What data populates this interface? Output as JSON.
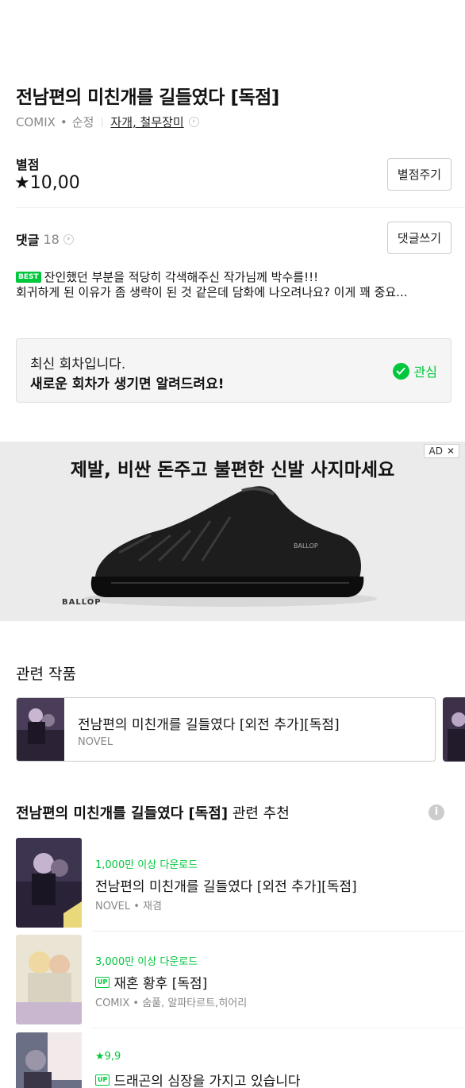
{
  "work": {
    "title": "전남편의 미친개를 길들였다 [독점]",
    "platform": "COMIX",
    "genre": "순정",
    "tags": "자개, 철무장미"
  },
  "rating": {
    "label": "별점",
    "value": "★10,00",
    "button": "별점주기"
  },
  "comments": {
    "label": "댓글",
    "count": "18",
    "button": "댓글쓰기",
    "best_badge": "BEST",
    "best_text": "잔인했던 부분을 적당히 각색해주신 작가님께 박수를!!!",
    "second_text": "회귀하게 된 이유가 좀 생략이 된 것 같은데 담화에 나오려나요? 이게 꽤 중요..."
  },
  "notice": {
    "line1": "최신 회차입니다.",
    "line2": "새로운 회차가 생기면 알려드려요!",
    "fav_label": "관심"
  },
  "ad": {
    "badge": "AD",
    "close": "✕",
    "title": "제발, 비싼 돈주고 불편한 신발 사지마세요",
    "brand": "BALLOP",
    "shoe_brand": "BALLOP"
  },
  "related": {
    "section_title": "관련 작품",
    "items": [
      {
        "title": "전남편의 미친개를 길들였다 [외전 추가][독점]",
        "type": "NOVEL"
      }
    ]
  },
  "recommend": {
    "title_bold": "전남편의 미친개를 길들였다 [독점]",
    "title_rest": " 관련 추천",
    "info": "i",
    "items": [
      {
        "tag": "1,000만 이상 다운로드",
        "up": "",
        "name": "전남편의 미친개를 길들였다 [외전 추가][독점]",
        "sub": "NOVEL • 재겸"
      },
      {
        "tag": "3,000만 이상 다운로드",
        "up": "UP",
        "name": "재혼 황후 [독점]",
        "sub": "COMIX • 숨풀, 알파타르트,히어리"
      },
      {
        "tag": "★9,9",
        "up": "UP",
        "name": "드래곤의 심장을 가지고 있습니다",
        "sub": ""
      }
    ]
  },
  "colors": {
    "accent": "#00c73c"
  }
}
